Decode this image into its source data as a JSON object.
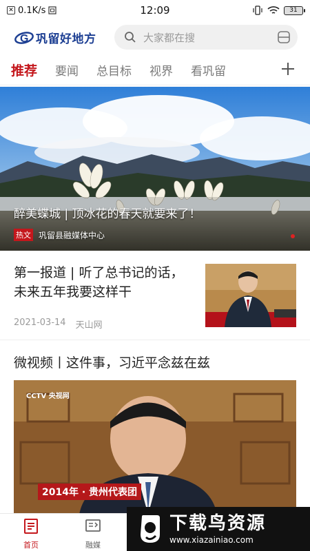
{
  "status_bar": {
    "speed": "0.1K/s",
    "time": "12:09",
    "battery": "31"
  },
  "header": {
    "logo_text": "巩留好地方",
    "search_placeholder": "大家都在搜"
  },
  "tabs": [
    {
      "label": "推荐",
      "active": true
    },
    {
      "label": "要闻",
      "active": false
    },
    {
      "label": "总目标",
      "active": false
    },
    {
      "label": "视界",
      "active": false
    },
    {
      "label": "看巩留",
      "active": false
    }
  ],
  "hero": {
    "title": "醉美蝶城 | 顶冰花的春天就要来了！",
    "badge": "热文",
    "source": "巩留县融媒体中心"
  },
  "news": [
    {
      "title": "第一报道 | 听了总书记的话，未来五年我要这样干",
      "date": "2021-03-14",
      "source": "天山网"
    },
    {
      "title": "微视频丨这件事，习近平念兹在兹",
      "caption": "2014年 · 贵州代表团",
      "channel_logo": "CCTV 央视网"
    }
  ],
  "bottom_nav": [
    {
      "label": "首页",
      "icon": "home-news-icon",
      "active": true
    },
    {
      "label": "融媒",
      "icon": "media-icon",
      "active": false
    }
  ],
  "watermark": {
    "title": "下载鸟资源",
    "url": "www.xiazainiao.com"
  },
  "colors": {
    "accent": "#c4171c",
    "logo_blue": "#1d3f93"
  }
}
